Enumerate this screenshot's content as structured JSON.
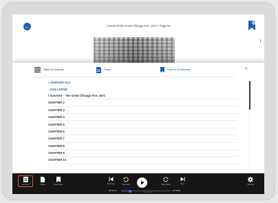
{
  "header": {
    "title": "I Survived the Great Chicago Fire, 1871 • Page 53"
  },
  "drawer": {
    "tabs": [
      {
        "label": "Table of Contents",
        "icon": "toc-icon"
      },
      {
        "label": "Pages",
        "icon": "pages-icon"
      },
      {
        "label": "Notes & Bookmarks",
        "icon": "bookmark-icon"
      }
    ],
    "actions": {
      "expand_all": "+ EXPAND ALL",
      "collapse": "- COLLAPSE"
    },
    "toc": [
      "I Survived -- The Great Chicago Fire, 1871",
      "CHAPTER 2",
      "CHAPTER 3",
      "CHAPTER 4",
      "CHAPTER 5",
      "CHAPTER 6",
      "CHAPTER 7",
      "CHAPTER 8",
      "CHAPTER 9",
      "CHAPTER 10"
    ]
  },
  "toolbar": {
    "contents": "Contents",
    "pages": "Pages",
    "bookmarks": "Bookmarks",
    "previous": "Previous",
    "rewind": "Skip back",
    "forward": "Skip ahead",
    "next": "Next",
    "settings": "Settings",
    "elapsed": "00:00:13",
    "remaining": "-00:00:58",
    "speed": "Speed 1.0",
    "progress": 0.18
  },
  "colors": {
    "accent": "#1f5db0",
    "toolbar_bg": "#161616",
    "active_outline": "#e05a3e"
  }
}
